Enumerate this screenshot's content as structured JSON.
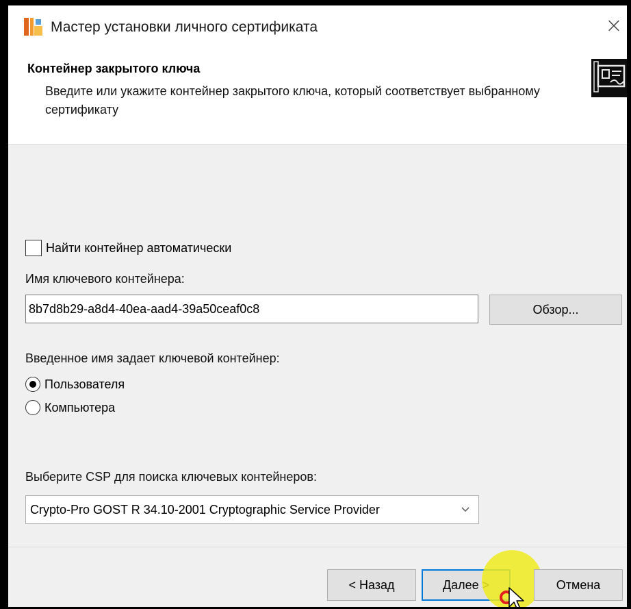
{
  "window": {
    "title": "Мастер установки личного сертификата",
    "close_symbol": "×",
    "app_icon": "cryptopro-icon",
    "close_icon": "close-icon"
  },
  "header": {
    "title": "Контейнер закрытого ключа",
    "description": "Введите или укажите контейнер закрытого ключа, который соответствует выбранному сертификату",
    "icon": "certificate-icon"
  },
  "form": {
    "auto_find_label": "Найти контейнер автоматически",
    "auto_find_checked": false,
    "container_name_label": "Имя ключевого контейнера:",
    "container_name_value": "8b7d8b29-a8d4-40ea-aad4-39a50ceaf0c8",
    "browse_label": "Обзор...",
    "key_owner_label": "Введенное имя задает ключевой контейнер:",
    "owner_options": [
      {
        "label": "Пользователя",
        "checked": true
      },
      {
        "label": "Компьютера",
        "checked": false
      }
    ],
    "csp_label": "Выберите CSP для поиска ключевых контейнеров:",
    "csp_selected": "Crypto-Pro GOST R 34.10-2001 Cryptographic Service Provider",
    "csp_chevron_icon": "chevron-down-icon"
  },
  "buttons": {
    "back_label": "< Назад",
    "next_label": "Далее >",
    "cancel_label": "Отмена"
  },
  "colors": {
    "window_bg": "#f0f0f0",
    "header_bg": "#ffffff",
    "button_bg": "#e1e1e1",
    "default_button_border": "#0078d7",
    "cursor_highlight": "#f0eb1e",
    "cursor_ring": "#e32020"
  }
}
